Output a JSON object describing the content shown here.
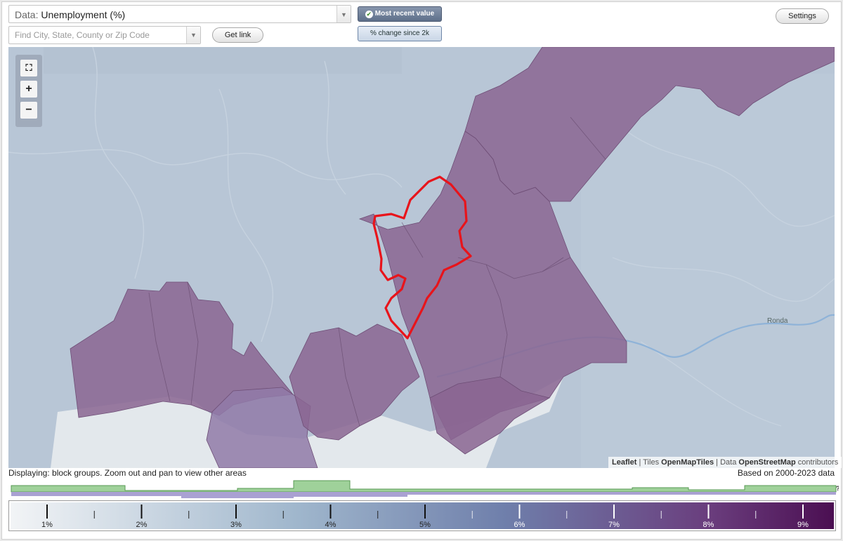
{
  "controls": {
    "data_prefix": "Data:",
    "data_value": "Unemployment (%)",
    "search_placeholder": "Find City, State, County or Zip Code",
    "get_link": "Get link",
    "most_recent": "Most recent value",
    "pct_change": "% change since 2k",
    "settings": "Settings"
  },
  "zoom": {
    "fullscreen": "⛶",
    "zoom_in": "+",
    "zoom_out": "−"
  },
  "map": {
    "place_label": "Ronda",
    "selected_area_outline_color": "#e8141b",
    "choropleth_color": "#8a6592",
    "base_color": "#b8c6d6"
  },
  "attribution": {
    "leaflet": "Leaflet",
    "tiles_label": "Tiles",
    "tiles_source": "OpenMapTiles",
    "data_label": "Data",
    "data_source": "OpenStreetMap",
    "contributors": "contributors"
  },
  "status": {
    "displaying": "Displaying: block groups. Zoom out and pan to view other areas",
    "based_on": "Based on 2000-2023 data"
  },
  "legend": {
    "ticks": [
      "1%",
      "2%",
      "3%",
      "4%",
      "5%",
      "6%",
      "7%",
      "8%",
      "9%"
    ],
    "color_start": "#f2f4f6",
    "color_mid": "#6f7fab",
    "color_end": "#4b0f52",
    "help": "?"
  }
}
